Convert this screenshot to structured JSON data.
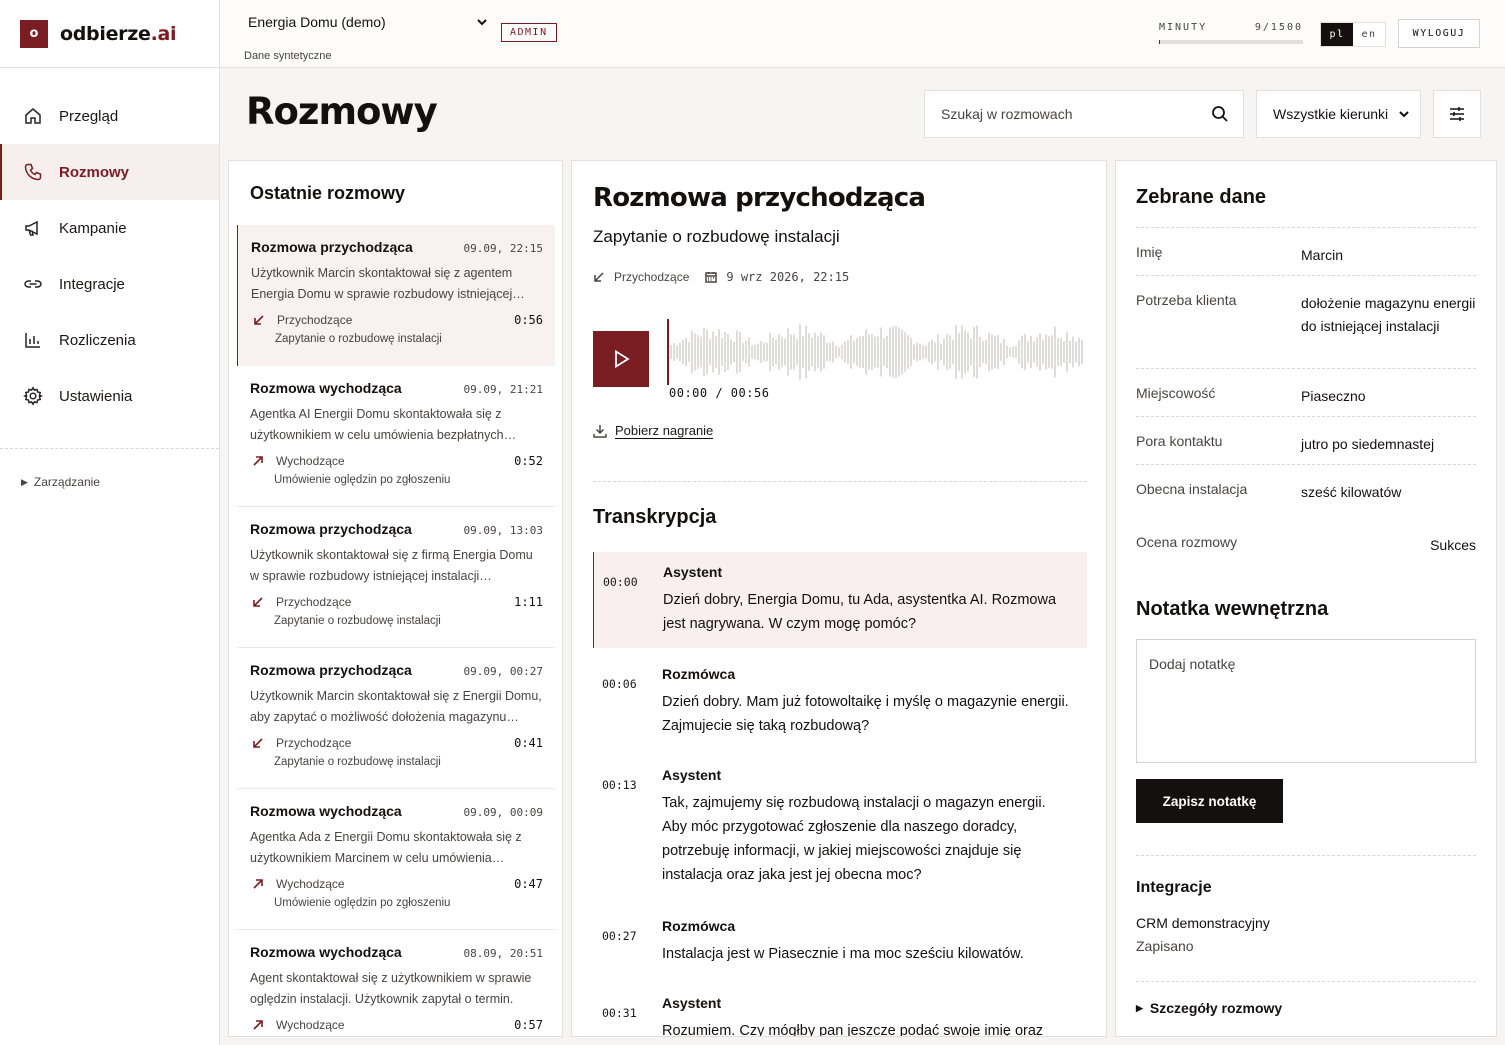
{
  "brand": {
    "mark": "o",
    "name": "odbierze",
    "tld": ".ai"
  },
  "nav": {
    "items": [
      {
        "label": "Przegląd",
        "icon": "home-icon"
      },
      {
        "label": "Rozmowy",
        "icon": "phone-icon",
        "active": true
      },
      {
        "label": "Kampanie",
        "icon": "megaphone-icon"
      },
      {
        "label": "Integracje",
        "icon": "link-icon"
      },
      {
        "label": "Rozliczenia",
        "icon": "bar-chart-icon"
      },
      {
        "label": "Ustawienia",
        "icon": "gear-icon"
      }
    ],
    "management": "Zarządzanie"
  },
  "topbar": {
    "tenant": "Energia Domu (demo)",
    "tenant_sub": "Dane syntetyczne",
    "admin_badge": "ADMIN",
    "minutes_label": "MINUTY",
    "minutes_value": "9/1500",
    "minutes_used": 9,
    "minutes_total": 1500,
    "lang": [
      "pl",
      "en"
    ],
    "lang_active": "pl",
    "logout": "WYLOGUJ"
  },
  "page": {
    "title": "Rozmowy",
    "search_placeholder": "Szukaj w rozmowach",
    "direction_filter": "Wszystkie kierunki"
  },
  "list": {
    "heading": "Ostatnie rozmowy",
    "items": [
      {
        "title": "Rozmowa przychodząca",
        "time": "09.09, 22:15",
        "desc": "Użytkownik Marcin skontaktował się z agentem Energia Domu w sprawie rozbudowy istniejącej instalacji fotowoltaicznej o magazyn energii.",
        "direction": "Przychodzące",
        "dir": "in",
        "duration": "0:56",
        "purpose": "Zapytanie o rozbudowę instalacji",
        "active": true
      },
      {
        "title": "Rozmowa wychodząca",
        "time": "09.09, 21:21",
        "desc": "Agentka AI Energii Domu skontaktowała się z użytkownikiem w celu umówienia bezpłatnych oględzin po zgłoszeniu.",
        "direction": "Wychodzące",
        "dir": "out",
        "duration": "0:52",
        "purpose": "Umówienie oględzin po zgłoszeniu"
      },
      {
        "title": "Rozmowa przychodząca",
        "time": "09.09, 13:03",
        "desc": "Użytkownik skontaktował się z firmą Energia Domu w sprawie rozbudowy istniejącej instalacji fotowoltaicznej.",
        "direction": "Przychodzące",
        "dir": "in",
        "duration": "1:11",
        "purpose": "Zapytanie o rozbudowę instalacji"
      },
      {
        "title": "Rozmowa przychodząca",
        "time": "09.09, 00:27",
        "desc": "Użytkownik Marcin skontaktował się z Energii Domu, aby zapytać o możliwość dołożenia magazynu energii.",
        "direction": "Przychodzące",
        "dir": "in",
        "duration": "0:41",
        "purpose": "Zapytanie o rozbudowę instalacji"
      },
      {
        "title": "Rozmowa wychodząca",
        "time": "09.09, 00:09",
        "desc": "Agentka Ada z Energii Domu skontaktowała się z użytkownikiem Marcinem w celu umówienia oględzin.",
        "direction": "Wychodzące",
        "dir": "out",
        "duration": "0:47",
        "purpose": "Umówienie oględzin po zgłoszeniu"
      },
      {
        "title": "Rozmowa wychodząca",
        "time": "08.09, 20:51",
        "desc": "Agent skontaktował się z użytkownikiem w sprawie oględzin instalacji. Użytkownik zapytał o termin.",
        "direction": "Wychodzące",
        "dir": "out",
        "duration": "0:57",
        "purpose": ""
      }
    ]
  },
  "detail": {
    "title": "Rozmowa przychodząca",
    "subtitle": "Zapytanie o rozbudowę instalacji",
    "direction": "Przychodzące",
    "datetime": "9 wrz 2026, 22:15",
    "timecode": "00:00 / 00:56",
    "download": "Pobierz nagranie",
    "transcript_heading": "Transkrypcja",
    "transcript": [
      {
        "ts": "00:00",
        "who": "Asystent",
        "text": "Dzień dobry, Energia Domu, tu Ada, asystentka AI. Rozmowa jest nagrywana. W czym mogę pomóc?",
        "active": true
      },
      {
        "ts": "00:06",
        "who": "Rozmówca",
        "text": "Dzień dobry. Mam już fotowoltaikę i myślę o magazynie energii. Zajmujecie się taką rozbudową?"
      },
      {
        "ts": "00:13",
        "who": "Asystent",
        "text": "Tak, zajmujemy się rozbudową instalacji o magazyn energii. Aby móc przygotować zgłoszenie dla naszego doradcy, potrzebuję informacji, w jakiej miejscowości znajduje się instalacja oraz jaka jest jej obecna moc?"
      },
      {
        "ts": "00:27",
        "who": "Rozmówca",
        "text": "Instalacja jest w Piasecznie i ma moc sześciu kilowatów."
      },
      {
        "ts": "00:31",
        "who": "Asystent",
        "text": "Rozumiem. Czy mógłby pan jeszcze podać swoje imię oraz"
      }
    ]
  },
  "collected": {
    "heading": "Zebrane dane",
    "fields": [
      {
        "key": "Imię",
        "value": "Marcin"
      },
      {
        "key": "Potrzeba klienta",
        "value": "dołożenie magazynu energii do istniejącej instalacji"
      },
      {
        "key": "Miejscowość",
        "value": "Piaseczno"
      },
      {
        "key": "Pora kontaktu",
        "value": "jutro po siedemnastej"
      },
      {
        "key": "Obecna instalacja",
        "value": "sześć kilowatów"
      },
      {
        "key": "Ocena rozmowy",
        "value": "Sukces"
      }
    ],
    "note_heading": "Notatka wewnętrzna",
    "note_placeholder": "Dodaj notatkę",
    "save_label": "Zapisz notatkę",
    "integrations_heading": "Integracje",
    "integration_name": "CRM demonstracyjny",
    "integration_status": "Zapisano",
    "details_label": "Szczegóły rozmowy"
  },
  "colors": {
    "accent": "#7a1d23",
    "ink": "#141010",
    "active_bg": "#f9f1f1"
  }
}
